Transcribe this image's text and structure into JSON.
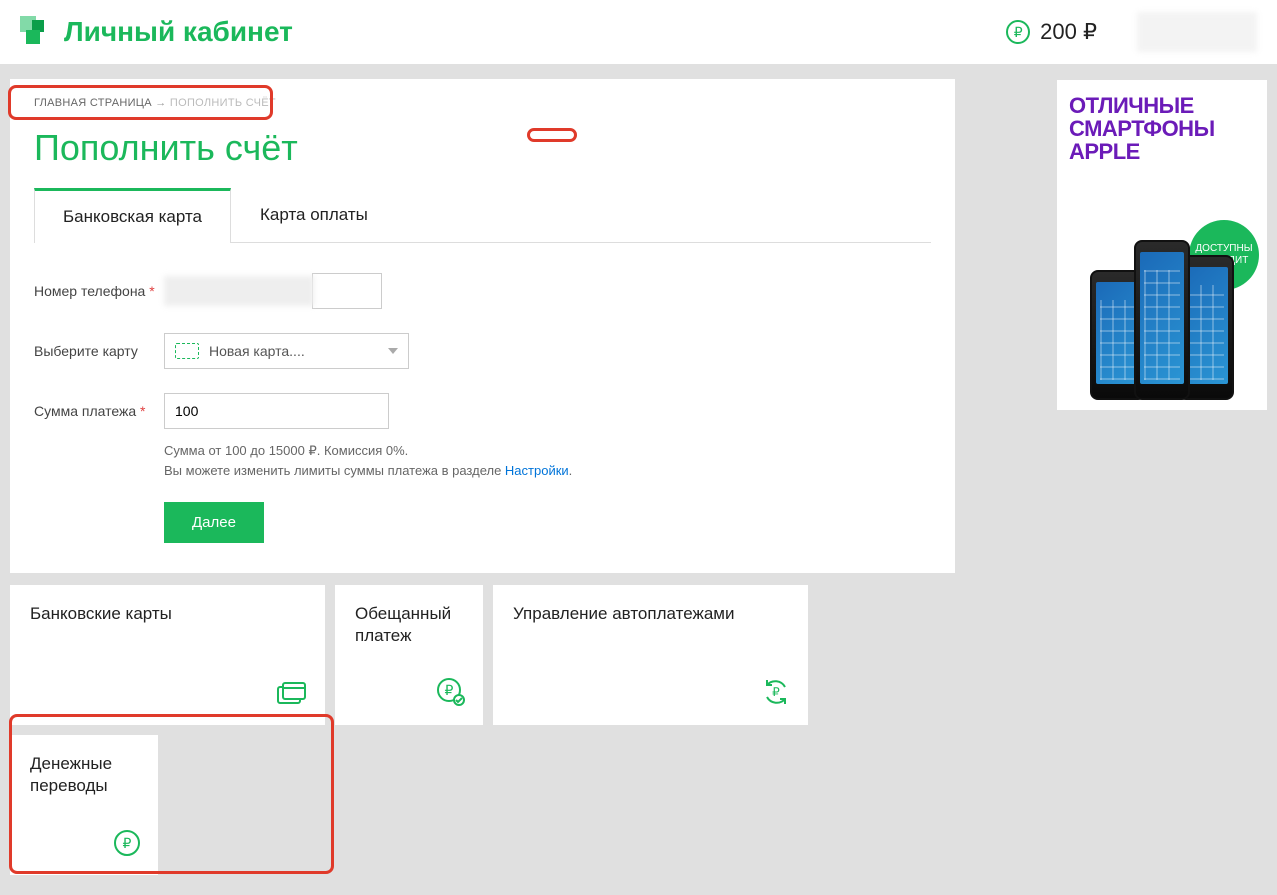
{
  "header": {
    "title": "Личный кабинет",
    "balance": "200 ₽"
  },
  "breadcrumb": {
    "home": "ГЛАВНАЯ СТРАНИЦА",
    "arrow": "→",
    "current": "ПОПОЛНИТЬ СЧЁТ"
  },
  "page_title": "Пополнить счёт",
  "tabs": {
    "bank": "Банковская карта",
    "paycard": "Карта оплаты"
  },
  "form": {
    "phone_label": "Номер телефона",
    "required_mark": "*",
    "select_card_label": "Выберите карту",
    "select_card_value": "Новая карта....",
    "amount_label": "Сумма платежа",
    "amount_value": "100",
    "hint_line1": "Сумма от 100 до 15000 ₽. Комиссия 0%.",
    "hint_line2_a": "Вы можете изменить лимиты суммы платежа в разделе ",
    "hint_link": "Настройки",
    "hint_line2_b": ".",
    "next_button": "Далее"
  },
  "cards": {
    "bank_cards": "Банковские карты",
    "promised": "Обещанный платеж",
    "autopay": "Управление автоплатежами",
    "transfers": "Денежные переводы"
  },
  "promo": {
    "line1": "ОТЛИЧНЫЕ",
    "line2": "СМАРТФОНЫ",
    "line3": "APPLE",
    "badge": "ДОСТУПНЫ В КРЕДИТ"
  }
}
